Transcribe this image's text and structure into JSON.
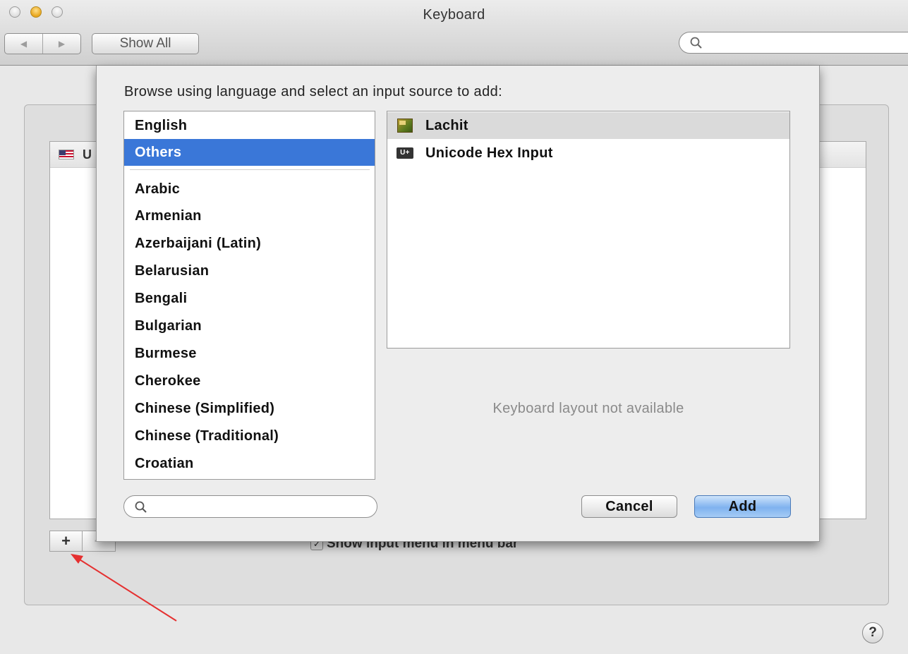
{
  "window": {
    "title": "Keyboard",
    "toolbar": {
      "back_label": "◀",
      "forward_label": "▶",
      "show_all_label": "Show All",
      "search_placeholder": ""
    }
  },
  "background": {
    "row_fragment": "U",
    "add_button": "+",
    "remove_button": "−",
    "checkbox_mark": "✓",
    "checkbox_label": "Show input menu in menu bar",
    "help_button": "?"
  },
  "sheet": {
    "prompt": "Browse using language and select an input source to add:",
    "languages": {
      "top": [
        "English",
        "Others"
      ],
      "selected": "Others",
      "rest": [
        "Arabic",
        "Armenian",
        "Azerbaijani (Latin)",
        "Belarusian",
        "Bengali",
        "Bulgarian",
        "Burmese",
        "Cherokee",
        "Chinese (Simplified)",
        "Chinese (Traditional)",
        "Croatian"
      ]
    },
    "sources": [
      {
        "label": "Lachit",
        "icon": "lachit-icon",
        "highlighted": true
      },
      {
        "label": "Unicode Hex Input",
        "icon": "unicode-hex-icon",
        "icon_text": "U+",
        "highlighted": false
      }
    ],
    "layout_message": "Keyboard layout not available",
    "search_placeholder": "",
    "cancel_label": "Cancel",
    "add_label": "Add"
  },
  "colors": {
    "selection": "#3a77d8",
    "default_button": "#7fb2ef",
    "annotation_arrow": "#e53030"
  }
}
